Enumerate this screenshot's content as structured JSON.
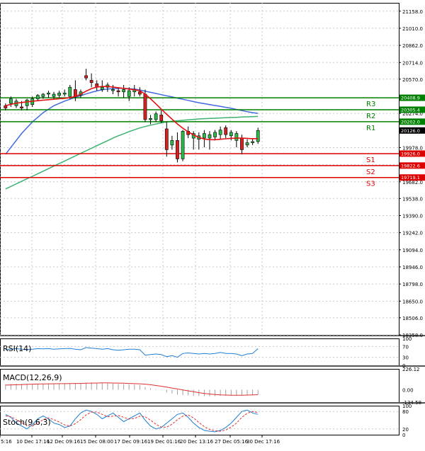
{
  "chart_data": [
    {
      "type": "line",
      "panel": "price",
      "title": "",
      "y_ticks": [
        21158.0,
        21010.0,
        20862.0,
        20714.0,
        20570.0,
        20274.0,
        19978.0,
        19830.0,
        19682.0,
        19538.0,
        19390.0,
        19242.0,
        19094.0,
        18946.0,
        18798.0,
        18650.0,
        18506.0,
        18358.0
      ],
      "ylim": [
        18358.0,
        21230.0
      ],
      "x_ticks": [
        "5:16",
        "10 Dec 17:16",
        "12 Dec 09:16",
        "15 Dec 08:00",
        "17 Dec 09:16",
        "19 Dec 01:16",
        "20 Dec 13:16",
        "27 Dec 05:16",
        "30 Dec 17:16"
      ],
      "current_price": {
        "label": "20126.0",
        "value": 20126.0
      },
      "levels": [
        {
          "name": "R3",
          "value": 20408.9,
          "label": "20408.9",
          "color": "#008000"
        },
        {
          "name": "R2",
          "value": 20305.4,
          "label": "20305.4",
          "color": "#008000"
        },
        {
          "name": "R1",
          "value": 20202.0,
          "label": "20202.0",
          "color": "#008000"
        },
        {
          "name": "S1",
          "value": 19926.0,
          "label": "19926.0",
          "color": "#dd0000"
        },
        {
          "name": "S2",
          "value": 19822.6,
          "label": "19822.6",
          "color": "#dd0000"
        },
        {
          "name": "S3",
          "value": 19719.1,
          "label": "19719.1",
          "color": "#dd0000"
        }
      ],
      "candles": [
        [
          20340,
          20360,
          20300,
          20320
        ],
        [
          20360,
          20420,
          20330,
          20400
        ],
        [
          20340,
          20400,
          20320,
          20380
        ],
        [
          20330,
          20380,
          20300,
          20320
        ],
        [
          20340,
          20400,
          20300,
          20390
        ],
        [
          20350,
          20420,
          20330,
          20400
        ],
        [
          20400,
          20440,
          20380,
          20430
        ],
        [
          20420,
          20450,
          20400,
          20440
        ],
        [
          20440,
          20470,
          20410,
          20450
        ],
        [
          20420,
          20460,
          20400,
          20440
        ],
        [
          20430,
          20470,
          20410,
          20450
        ],
        [
          20440,
          20480,
          20420,
          20450
        ],
        [
          20420,
          20520,
          20400,
          20500
        ],
        [
          20480,
          20560,
          20380,
          20420
        ],
        [
          20430,
          20480,
          20410,
          20460
        ],
        [
          20600,
          20660,
          20560,
          20580
        ],
        [
          20560,
          20620,
          20500,
          20540
        ],
        [
          20530,
          20560,
          20470,
          20500
        ],
        [
          20480,
          20560,
          20460,
          20500
        ],
        [
          20500,
          20540,
          20460,
          20520
        ],
        [
          20470,
          20520,
          20440,
          20480
        ],
        [
          20470,
          20500,
          20420,
          20460
        ],
        [
          20460,
          20520,
          20410,
          20480
        ],
        [
          20420,
          20500,
          20380,
          20470
        ],
        [
          20460,
          20520,
          20420,
          20480
        ],
        [
          20460,
          20500,
          20420,
          20440
        ],
        [
          20440,
          20480,
          20200,
          20220
        ],
        [
          20220,
          20260,
          20180,
          20230
        ],
        [
          20220,
          20290,
          20200,
          20270
        ],
        [
          20260,
          20300,
          20190,
          20210
        ],
        [
          20140,
          20200,
          19900,
          19960
        ],
        [
          20000,
          20080,
          19960,
          20040
        ],
        [
          20040,
          20110,
          19850,
          19880
        ],
        [
          19880,
          20130,
          19860,
          20120
        ],
        [
          20120,
          20160,
          20060,
          20090
        ],
        [
          20060,
          20120,
          19960,
          20100
        ],
        [
          20050,
          20110,
          19960,
          20080
        ],
        [
          20060,
          20130,
          19980,
          20100
        ],
        [
          20060,
          20120,
          19960,
          20090
        ],
        [
          20070,
          20130,
          20040,
          20110
        ],
        [
          20090,
          20160,
          20050,
          20130
        ],
        [
          20150,
          20170,
          20060,
          20090
        ],
        [
          20080,
          20130,
          20040,
          20110
        ],
        [
          20040,
          20120,
          19980,
          20100
        ],
        [
          20060,
          20090,
          19920,
          19960
        ],
        [
          20000,
          20050,
          19980,
          20020
        ],
        [
          20020,
          20060,
          20000,
          20030
        ],
        [
          20030,
          20150,
          20010,
          20126
        ]
      ],
      "ma_fast": [
        20340,
        20352,
        20362,
        20368,
        20374,
        20379,
        20384,
        20388,
        20392,
        20396,
        20400,
        20404,
        20410,
        20420,
        20440,
        20466,
        20488,
        20502,
        20506,
        20506,
        20502,
        20496,
        20490,
        20484,
        20478,
        20470,
        20440,
        20400,
        20356,
        20310,
        20266,
        20224,
        20182,
        20146,
        20114,
        20088,
        20066,
        20052,
        20046,
        20046,
        20050,
        20054,
        20058,
        20060,
        20060,
        20058,
        20055,
        20056
      ],
      "ma_mid": [
        19920,
        19980,
        20040,
        20100,
        20150,
        20200,
        20240,
        20280,
        20310,
        20340,
        20360,
        20380,
        20396,
        20412,
        20428,
        20442,
        20456,
        20468,
        20478,
        20484,
        20488,
        20490,
        20490,
        20488,
        20484,
        20476,
        20466,
        20456,
        20446,
        20436,
        20426,
        20416,
        20406,
        20396,
        20386,
        20376,
        20366,
        20358,
        20350,
        20342,
        20334,
        20326,
        20318,
        20308,
        20298,
        20288,
        20280,
        20274
      ],
      "ma_slow": [
        19620,
        19642,
        19664,
        19686,
        19708,
        19730,
        19752,
        19774,
        19796,
        19818,
        19840,
        19862,
        19884,
        19906,
        19928,
        19950,
        19972,
        19994,
        20016,
        20038,
        20060,
        20080,
        20098,
        20116,
        20132,
        20148,
        20160,
        20172,
        20182,
        20192,
        20200,
        20206,
        20210,
        20214,
        20218,
        20222,
        20226,
        20228,
        20230,
        20232,
        20234,
        20236,
        20238,
        20240,
        20242,
        20244,
        20246,
        20248
      ]
    },
    {
      "type": "line",
      "panel": "rsi",
      "label": "RSI(14)",
      "y_ticks": [
        100,
        70,
        30,
        0
      ],
      "ylim": [
        0,
        100
      ],
      "values": [
        58,
        60,
        62,
        60,
        58,
        60,
        62,
        61,
        62,
        60,
        61,
        62,
        63,
        60,
        58,
        66,
        64,
        62,
        60,
        62,
        58,
        56,
        58,
        60,
        60,
        58,
        38,
        40,
        42,
        40,
        32,
        36,
        30,
        44,
        46,
        44,
        42,
        44,
        42,
        44,
        48,
        44,
        44,
        42,
        36,
        42,
        44,
        62
      ]
    },
    {
      "type": "bar",
      "panel": "macd",
      "label": "MACD(12,26,9)",
      "y_ticks": [
        226.12,
        0.0,
        -134.58
      ],
      "ylim": [
        -134.58,
        226.12
      ],
      "histogram": [
        60,
        62,
        64,
        64,
        62,
        62,
        64,
        66,
        68,
        66,
        66,
        68,
        70,
        66,
        64,
        76,
        78,
        76,
        72,
        70,
        66,
        62,
        60,
        58,
        56,
        52,
        30,
        16,
        6,
        -4,
        -30,
        -40,
        -54,
        -58,
        -62,
        -66,
        -68,
        -70,
        -72,
        -70,
        -66,
        -64,
        -62,
        -60,
        -60,
        -58,
        -56,
        -50
      ],
      "signal": [
        50,
        52,
        54,
        56,
        58,
        60,
        62,
        63,
        64,
        65,
        66,
        66,
        67,
        68,
        68,
        70,
        72,
        73,
        74,
        74,
        73,
        72,
        70,
        68,
        66,
        64,
        60,
        54,
        46,
        38,
        28,
        18,
        8,
        -2,
        -12,
        -22,
        -32,
        -40,
        -46,
        -52,
        -56,
        -58,
        -60,
        -60,
        -60,
        -58,
        -56,
        -54
      ]
    },
    {
      "type": "line",
      "panel": "stoch",
      "label": "Stoch(9,6,3)",
      "y_ticks": [
        100,
        80,
        20,
        0
      ],
      "ylim": [
        0,
        100
      ],
      "k": [
        70,
        60,
        40,
        30,
        20,
        35,
        55,
        65,
        55,
        40,
        35,
        25,
        30,
        55,
        75,
        85,
        80,
        70,
        55,
        65,
        75,
        60,
        45,
        55,
        65,
        75,
        50,
        30,
        20,
        25,
        40,
        55,
        70,
        75,
        60,
        40,
        25,
        15,
        12,
        10,
        15,
        25,
        40,
        60,
        80,
        85,
        75,
        70
      ],
      "d": [
        65,
        62,
        52,
        42,
        32,
        30,
        40,
        52,
        58,
        52,
        44,
        34,
        30,
        38,
        52,
        68,
        78,
        78,
        70,
        62,
        64,
        66,
        60,
        54,
        56,
        64,
        62,
        50,
        36,
        26,
        26,
        36,
        52,
        64,
        68,
        58,
        42,
        28,
        18,
        14,
        12,
        16,
        26,
        40,
        60,
        74,
        80,
        76
      ]
    }
  ]
}
